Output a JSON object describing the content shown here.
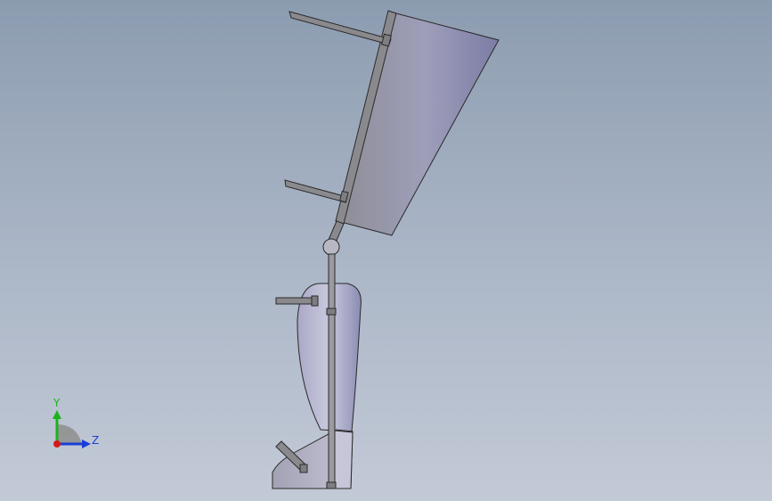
{
  "viewport": {
    "background_top": "#8c9cb0",
    "background_bottom": "#c3cad7"
  },
  "model": {
    "colors": {
      "outline": "#2a2a2a",
      "metal": "#7d7d82",
      "metal_light": "#9a9aa0",
      "shell_light": "#b8b8cc",
      "shell_mid": "#9a9abf",
      "shell_dark": "#76769c",
      "frame": "#8a8a8e"
    }
  },
  "triad": {
    "y_label": "Y",
    "z_label": "Z",
    "colors": {
      "y_axis": "#1bb31b",
      "z_axis": "#1a3fd6",
      "x_axis": "#d61a1a",
      "plane": "#8e8e8e"
    }
  }
}
